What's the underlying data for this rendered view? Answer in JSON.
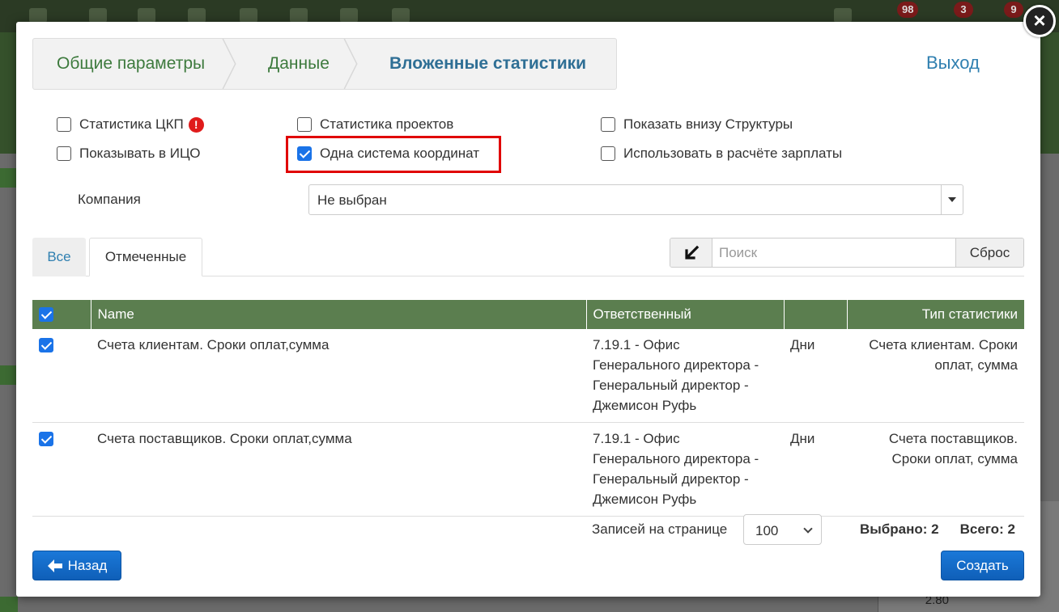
{
  "background": {
    "badges": [
      "98",
      "3",
      "9"
    ],
    "chart_label": "2.80"
  },
  "modal": {
    "wizard_steps": [
      "Общие параметры",
      "Данные",
      "Вложенные статистики"
    ],
    "logout_label": "Выход",
    "checkboxes": {
      "ckp_stat": {
        "label": "Статистика ЦКП",
        "checked": false,
        "warning": "!"
      },
      "show_in_ico": {
        "label": "Показывать в ИЦО",
        "checked": false
      },
      "project_stat": {
        "label": "Статистика проектов",
        "checked": false
      },
      "single_coords": {
        "label": "Одна система координат",
        "checked": true
      },
      "show_structure": {
        "label": "Показать внизу Структуры",
        "checked": false
      },
      "use_in_salary": {
        "label": "Использовать в расчёте зарплаты",
        "checked": false
      }
    },
    "company": {
      "label": "Компания",
      "value": "Не выбран"
    },
    "tabs": {
      "all": "Все",
      "marked": "Отмеченные"
    },
    "search": {
      "placeholder": "Поиск",
      "reset_label": "Сброс"
    },
    "table": {
      "headers": [
        "",
        "Name",
        "Ответственный",
        "",
        "Тип статистики"
      ],
      "rows": [
        {
          "checked": true,
          "name": "Счета клиентам. Сроки оплат,сумма",
          "responsible": [
            "7.19.1 - Офис",
            "Генерального директора -",
            "Генеральный директор -",
            "Джемисон Руфь"
          ],
          "period": "Дни",
          "type": [
            "Счета клиентам. Сроки",
            "оплат, сумма"
          ]
        },
        {
          "checked": true,
          "name": "Счета поставщиков. Сроки оплат,сумма",
          "responsible": [
            "7.19.1 - Офис",
            "Генерального директора -",
            "Генеральный директор -",
            "Джемисон Руфь"
          ],
          "period": "Дни",
          "type": [
            "Счета поставщиков.",
            "Сроки оплат, сумма"
          ]
        }
      ]
    },
    "pagination": {
      "per_page_label": "Записей на странице",
      "per_page_value": "100"
    },
    "counts": {
      "selected": "Выбрано: 2",
      "total": "Всего: 2"
    },
    "buttons": {
      "back": "Назад",
      "create": "Создать"
    },
    "colors": {
      "header_green": "#5b7e4f",
      "primary_blue": "#1a73e8",
      "highlight_red": "#e00000"
    }
  }
}
